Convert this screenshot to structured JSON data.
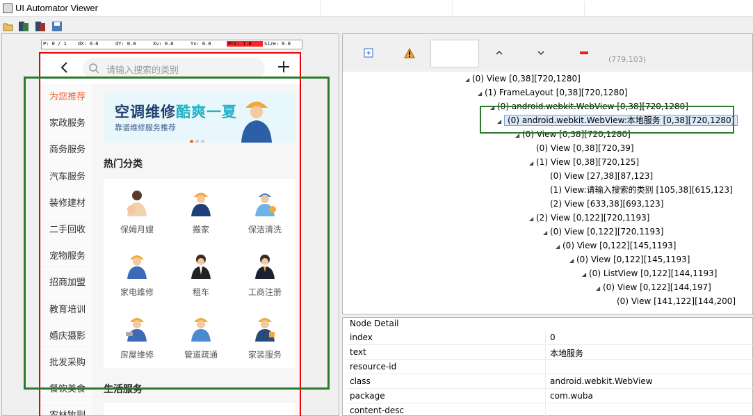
{
  "window": {
    "title": "UI Automator Viewer"
  },
  "toolbar": {
    "buttons": [
      "open-icon",
      "device-screenshot-icon",
      "device-screenshot-compressed-icon",
      "save-icon"
    ]
  },
  "ruler": {
    "p": "P: 0 / 1",
    "dx": "dX: 0.0",
    "dy": "dY: 0.0",
    "xv": "Xv: 0.0",
    "yv": "Yv: 0.0",
    "prs": "Prs: 1.0",
    "size": "Size: 0.0"
  },
  "phone": {
    "search_placeholder": "请输入搜索的类别",
    "side_categories": [
      "为您推荐",
      "家政服务",
      "商务服务",
      "汽车服务",
      "装修建材",
      "二手回收",
      "宠物服务",
      "招商加盟",
      "教育培训",
      "婚庆摄影",
      "批发采购",
      "餐饮美食",
      "农林牧副渔"
    ],
    "banner": {
      "title_a": "空调维修",
      "title_b": "酷爽一夏",
      "subtitle": "靠谱维修服务推荐"
    },
    "hot_section": "热门分类",
    "hot_items": [
      "保姆月嫂",
      "搬家",
      "保洁清洗",
      "家电维修",
      "租车",
      "工商注册",
      "房屋维修",
      "管道疏通",
      "家装服务"
    ],
    "life_section": "生活服务"
  },
  "tree_panel": {
    "coords": "(779,103)",
    "rows": [
      {
        "text": "(0) View [0,38][720,1280]",
        "arrow": "◢"
      },
      {
        "text": "(1) FrameLayout [0,38][720,1280]",
        "arrow": "◢"
      },
      {
        "text": "(0) android.webkit.WebView [0,38][720,1280]",
        "arrow": "◢"
      },
      {
        "text": "(0) android.webkit.WebView:本地服务 [0,38][720,1280]",
        "arrow": "◢",
        "selected": true
      },
      {
        "text": "(0) View [0,38][720,1280]",
        "arrow": "◢"
      },
      {
        "text": "(0) View [0,38][720,39]",
        "arrow": ""
      },
      {
        "text": "(1) View [0,38][720,125]",
        "arrow": "◢"
      },
      {
        "text": "(0) View [27,38][87,123]",
        "arrow": ""
      },
      {
        "text": "(1) View:请输入搜索的类别 [105,38][615,123]",
        "arrow": ""
      },
      {
        "text": "(2) View [633,38][693,123]",
        "arrow": ""
      },
      {
        "text": "(2) View [0,122][720,1193]",
        "arrow": "◢"
      },
      {
        "text": "(0) View [0,122][720,1193]",
        "arrow": "◢"
      },
      {
        "text": "(0) View [0,122][145,1193]",
        "arrow": "◢"
      },
      {
        "text": "(0) View [0,122][145,1193]",
        "arrow": "◢"
      },
      {
        "text": "(0) ListView [0,122][144,1193]",
        "arrow": "◢"
      },
      {
        "text": "(0) View [0,122][144,197]",
        "arrow": "◢"
      },
      {
        "text": "(0) View [141,122][144,200]",
        "arrow": ""
      }
    ]
  },
  "node_detail": {
    "title": "Node Detail",
    "rows": [
      {
        "key": "index",
        "value": "0"
      },
      {
        "key": "text",
        "value": "本地服务"
      },
      {
        "key": "resource-id",
        "value": ""
      },
      {
        "key": "class",
        "value": "android.webkit.WebView"
      },
      {
        "key": "package",
        "value": "com.wuba"
      },
      {
        "key": "content-desc",
        "value": ""
      }
    ]
  }
}
